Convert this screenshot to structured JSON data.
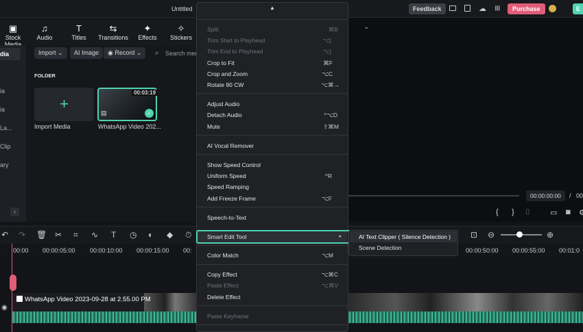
{
  "topbar": {
    "title": "Untitled",
    "feedback": "Feedback",
    "purchase": "Purchase",
    "export_short": "E"
  },
  "tools": [
    {
      "label": "Stock Media",
      "icon": "stock-media-icon"
    },
    {
      "label": "Audio",
      "icon": "audio-icon"
    },
    {
      "label": "Titles",
      "icon": "titles-icon"
    },
    {
      "label": "Transitions",
      "icon": "transitions-icon"
    },
    {
      "label": "Effects",
      "icon": "effects-icon"
    },
    {
      "label": "Stickers",
      "icon": "stickers-icon"
    }
  ],
  "leftnav": [
    "dia",
    "ia",
    "ia",
    "La...",
    "Clip",
    "ary"
  ],
  "media": {
    "import": "Import",
    "ai_image": "AI Image",
    "record": "Record",
    "search_placeholder": "Search med",
    "folder": "FOLDER",
    "import_media": "Import Media",
    "clip_name": "WhatsApp Video 202...",
    "clip_duration": "00:03:19"
  },
  "preview": {
    "time_current": "00:00:00:00",
    "time_sep": "/",
    "time_total": "00"
  },
  "timeline": {
    "ticks": [
      "00:00",
      "00:00:05:00",
      "00:00:10:00",
      "00:00:15:00",
      "00:",
      "00:00:50:00",
      "00:00:55:00",
      "00:01:0"
    ],
    "clip_label": "WhatsApp Video 2023-09-28 at 2.55.00 PM"
  },
  "menu": {
    "items": [
      {
        "label": "Split",
        "shortcut": "⌘B",
        "disabled": true
      },
      {
        "label": "Trim Start to Playhead",
        "shortcut": "⌥[",
        "disabled": true
      },
      {
        "label": "Trim End to Playhead",
        "shortcut": "⌥]",
        "disabled": true
      },
      {
        "label": "Crop to Fit",
        "shortcut": "⌘F",
        "disabled": false
      },
      {
        "label": "Crop and Zoom",
        "shortcut": "⌥C",
        "disabled": false
      },
      {
        "label": "Rotate 90 CW",
        "shortcut": "⌥⌘→",
        "disabled": false
      },
      {
        "label": "Adjust Audio",
        "shortcut": "",
        "disabled": false
      },
      {
        "label": "Detach Audio",
        "shortcut": "^⌥D",
        "disabled": false
      },
      {
        "label": "Mute",
        "shortcut": "⇧⌘M",
        "disabled": false
      },
      {
        "label": "AI Vocal Remover",
        "shortcut": "",
        "disabled": false
      },
      {
        "label": "Show Speed Control",
        "shortcut": "",
        "disabled": false
      },
      {
        "label": "Uniform Speed",
        "shortcut": "^R",
        "disabled": false
      },
      {
        "label": "Speed Ramping",
        "shortcut": "",
        "disabled": false
      },
      {
        "label": "Add Freeze Frame",
        "shortcut": "⌥F",
        "disabled": false
      },
      {
        "label": "Speech-to-Text",
        "shortcut": "",
        "disabled": false
      },
      {
        "label": "Smart Edit Tool",
        "shortcut": "▸",
        "disabled": false
      },
      {
        "label": "Color Match",
        "shortcut": "⌥M",
        "disabled": false
      },
      {
        "label": "Copy Effect",
        "shortcut": "⌥⌘C",
        "disabled": false
      },
      {
        "label": "Paste Effect",
        "shortcut": "⌥⌘V",
        "disabled": true
      },
      {
        "label": "Delete Effect",
        "shortcut": "",
        "disabled": false
      },
      {
        "label": "Paste Keyframe",
        "shortcut": "",
        "disabled": true
      }
    ]
  },
  "submenu": {
    "items": [
      "AI Text Clipper ( Silence Detection )",
      "Scene Detection"
    ]
  },
  "colors": {
    "accent": "#4fd3b1",
    "purchase": "#e05c77",
    "bg": "#121417"
  }
}
